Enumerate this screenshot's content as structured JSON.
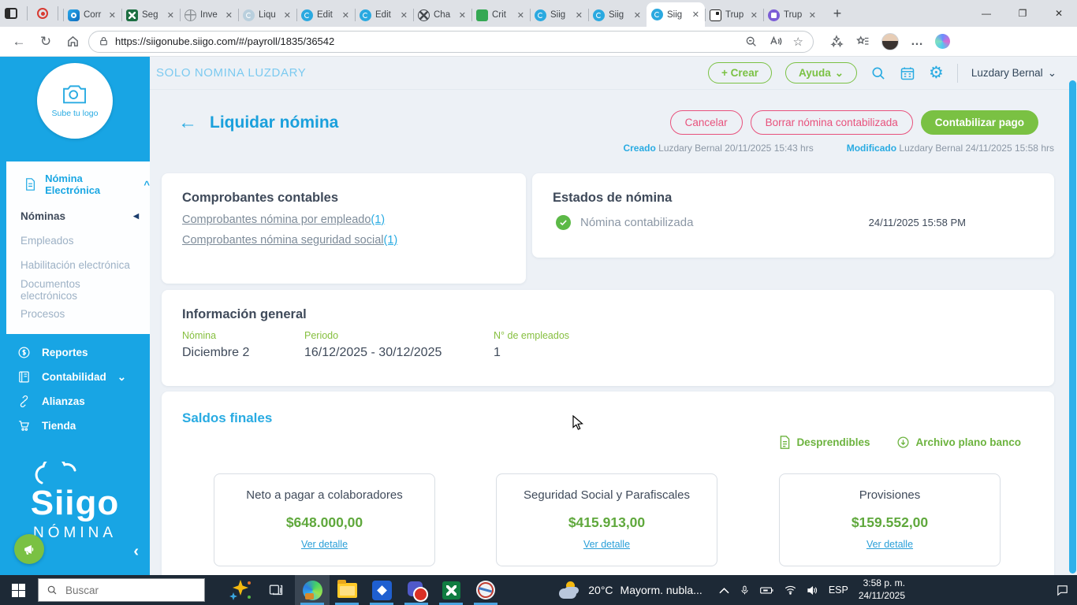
{
  "glyphs": {
    "close": "✕",
    "plus": "+",
    "minimize": "—",
    "restore": "❐",
    "back": "←",
    "refresh": "↻",
    "chev_down": "⌄",
    "chev_up": "^",
    "tri_left": "◀",
    "collapse": "‹",
    "ellipsis": "…",
    "star": "☆",
    "gear": "⚙"
  },
  "colors": {
    "siigo_blue": "#18a5e4",
    "link_blue": "#29abe2",
    "green": "#7ac143",
    "money_green": "#5fa83c",
    "pink": "#e8517c",
    "page_bg": "#edf1f6"
  },
  "browser": {
    "tabs": [
      {
        "label": "Corr",
        "icon": "outlook"
      },
      {
        "label": "Seg",
        "icon": "excel"
      },
      {
        "label": "Inve",
        "icon": "globe"
      },
      {
        "label": "Liqu",
        "icon": "siigo-faded"
      },
      {
        "label": "Edit",
        "icon": "siigo"
      },
      {
        "label": "Edit",
        "icon": "siigo"
      },
      {
        "label": "Cha",
        "icon": "chatgpt"
      },
      {
        "label": "Crit",
        "icon": "green-app"
      },
      {
        "label": "Siig",
        "icon": "siigo"
      },
      {
        "label": "Siig",
        "icon": "siigo"
      },
      {
        "label": "Siig",
        "icon": "siigo",
        "active": true
      },
      {
        "label": "Trup",
        "icon": "trupper-light"
      },
      {
        "label": "Trup",
        "icon": "trupper-purple"
      }
    ],
    "url": "https://siigonube.siigo.com/#/payroll/1835/36542"
  },
  "sidebar": {
    "logo_text": "Sube tu logo",
    "section": "Nómina Electrónica",
    "submenu": [
      "Nóminas",
      "Empleados",
      "Habilitación electrónica",
      "Documentos electrónicos",
      "Procesos"
    ],
    "menu": [
      "Reportes",
      "Contabilidad",
      "Alianzas",
      "Tienda"
    ],
    "brand_name": "Siigo",
    "brand_product": "NÓMINA"
  },
  "app_header": {
    "company": "SOLO NOMINA LUZDARY",
    "crear": "+ Crear",
    "ayuda": "Ayuda",
    "user": "Luzdary Bernal"
  },
  "page": {
    "title": "Liquidar nómina",
    "buttons": {
      "cancel": "Cancelar",
      "delete": "Borrar nómina contabilizada",
      "post": "Contabilizar pago"
    },
    "meta": {
      "created_label": "Creado",
      "created_value": "Luzdary Bernal 20/11/2025 15:43 hrs",
      "modified_label": "Modificado",
      "modified_value": "Luzdary Bernal 24/11/2025 15:58 hrs"
    },
    "comprobantes": {
      "title": "Comprobantes contables",
      "links": [
        {
          "text": "Comprobantes nómina por empleado",
          "count": "(1)"
        },
        {
          "text": "Comprobantes nómina seguridad social",
          "count": "(1)"
        }
      ]
    },
    "estados": {
      "title": "Estados de nómina",
      "status": "Nómina contabilizada",
      "timestamp": "24/11/2025 15:58 PM"
    },
    "info_general": {
      "title": "Información general",
      "fields": [
        {
          "label": "Nómina",
          "value": "Diciembre 2"
        },
        {
          "label": "Periodo",
          "value": "16/12/2025 - 30/12/2025"
        },
        {
          "label": "N° de empleados",
          "value": "1"
        }
      ]
    },
    "saldos": {
      "title": "Saldos finales",
      "actions": [
        {
          "label": "Desprendibles",
          "icon": "document"
        },
        {
          "label": "Archivo plano banco",
          "icon": "download"
        }
      ],
      "cards": [
        {
          "title": "Neto a pagar a colaboradores",
          "amount": "$648.000,00",
          "link": "Ver detalle"
        },
        {
          "title": "Seguridad Social y Parafiscales",
          "amount": "$415.913,00",
          "link": "Ver detalle"
        },
        {
          "title": "Provisiones",
          "amount": "$159.552,00",
          "link": "Ver detalle"
        }
      ]
    }
  },
  "taskbar": {
    "search_placeholder": "Buscar",
    "apps": [
      "edge",
      "file-explorer",
      "blue-app",
      "teams",
      "excel",
      "snipping-tool"
    ],
    "weather": {
      "temp": "20°C",
      "condition": "Mayorm. nubla..."
    },
    "language": "ESP",
    "time": "3:58 p. m.",
    "date": "24/11/2025"
  }
}
